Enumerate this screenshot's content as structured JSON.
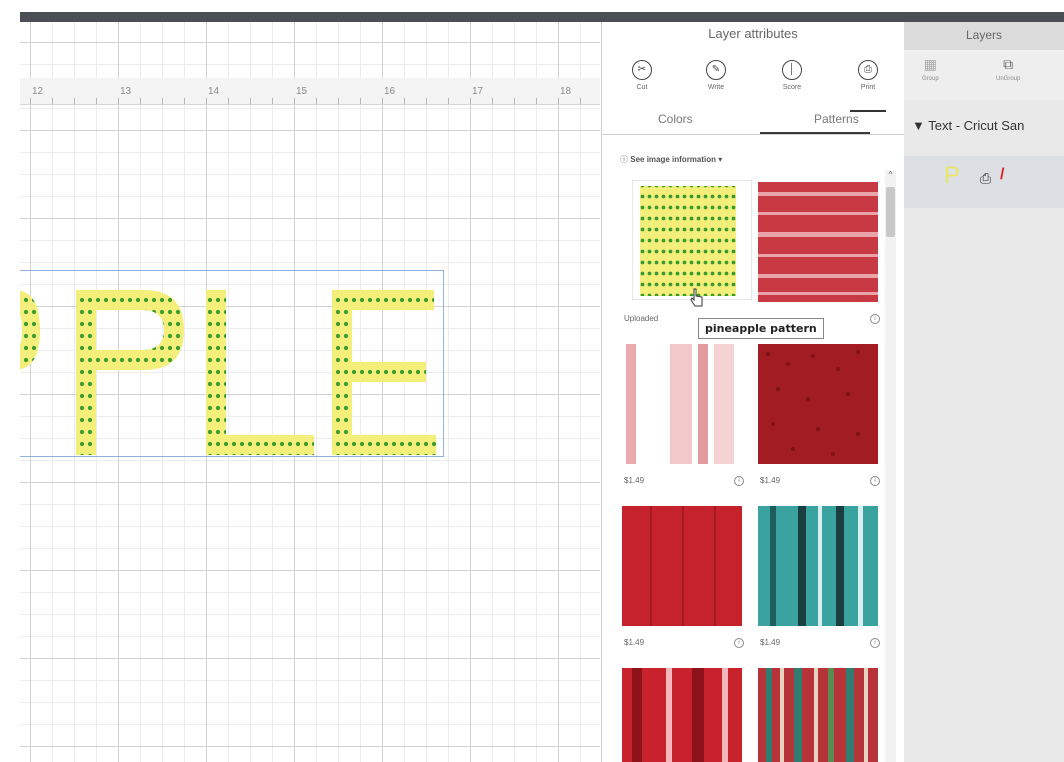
{
  "canvas": {
    "ruler_ticks": [
      "12",
      "13",
      "14",
      "15",
      "16",
      "17",
      "18"
    ],
    "text_letters": "PLE"
  },
  "attributes_panel": {
    "title": "Layer attributes",
    "tools": [
      {
        "label": "Cut",
        "icon": "scissors-icon"
      },
      {
        "label": "Write",
        "icon": "pen-icon"
      },
      {
        "label": "Score",
        "icon": "score-icon"
      },
      {
        "label": "Print",
        "icon": "printer-icon"
      }
    ],
    "tabs": [
      "Colors",
      "Patterns"
    ],
    "active_tab": "Patterns",
    "see_image_info": "See image information",
    "tooltip": "pineapple pattern",
    "patterns": [
      {
        "label": "Uploaded",
        "swatch": "pineapple",
        "selected": true
      },
      {
        "label": "",
        "swatch": "red-stripes"
      },
      {
        "label": "$1.49",
        "swatch": "pink-stripes"
      },
      {
        "label": "$1.49",
        "swatch": "dark-red-dots"
      },
      {
        "label": "$1.49",
        "swatch": "red-plaid"
      },
      {
        "label": "$1.49",
        "swatch": "teal-stripes"
      },
      {
        "label": "",
        "swatch": "red-buffalo"
      },
      {
        "label": "",
        "swatch": "multi-stripes"
      }
    ]
  },
  "layers_panel": {
    "title": "Layers",
    "tools": [
      {
        "label": "Group",
        "icon": "group-icon"
      },
      {
        "label": "UnGroup",
        "icon": "ungroup-icon"
      }
    ],
    "group_label": "Text - Cricut San",
    "layer_row": {
      "thumbnail_letter": "P",
      "icons": [
        "printer-icon",
        "no-color-slash-icon"
      ]
    }
  },
  "colors": {
    "letter_fill": "#f3ef7a",
    "dot_green": "#3a9b2e",
    "selection_box": "#8fb3dc",
    "top_bar": "#4b4f55"
  }
}
